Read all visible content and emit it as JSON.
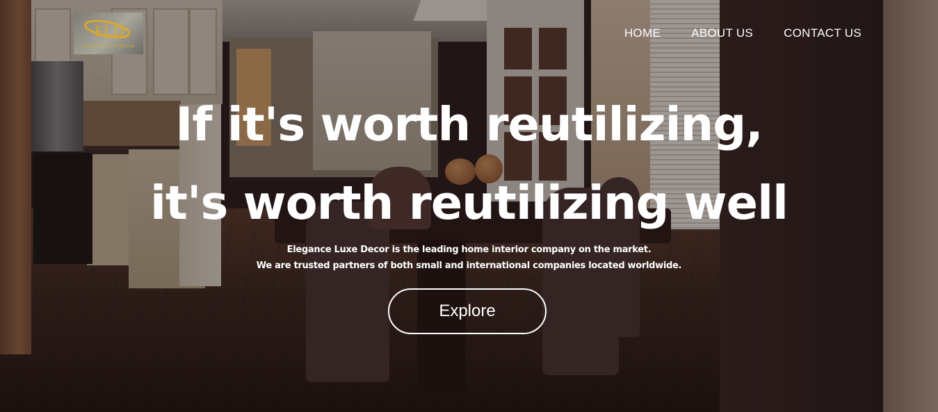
{
  "logo": {
    "monogram": "ELD",
    "text": "ELEGANCE LUXE DECOR"
  },
  "nav": {
    "items": [
      {
        "label": "HOME"
      },
      {
        "label": "ABOUT US"
      },
      {
        "label": "CONTACT US"
      }
    ]
  },
  "hero": {
    "headline_line1": "If it's worth reutilizing,",
    "headline_line2": "it's worth reutilizing well",
    "subtext_line1": "Elegance Luxe Decor is the leading home interior company on the market.",
    "subtext_line2": "We are trusted partners of both small and international companies located worldwide.",
    "cta_label": "Explore"
  },
  "colors": {
    "text": "#ffffff",
    "logo_gold": "#d6a92b",
    "overlay": "#120a0e"
  }
}
